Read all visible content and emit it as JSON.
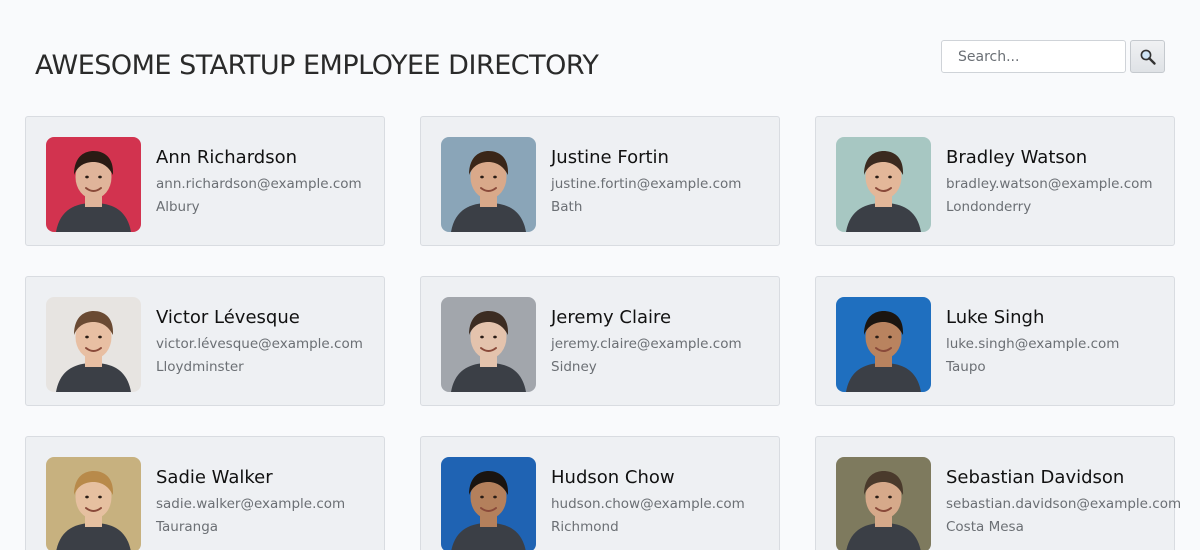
{
  "header": {
    "title": "AWESOME STARTUP EMPLOYEE DIRECTORY",
    "search_placeholder": "Search...",
    "search_icon": "magnifier-icon"
  },
  "employees": [
    {
      "name": "Ann Richardson",
      "email": "ann.richardson@example.com",
      "city": "Albury",
      "bg": "#d2334f",
      "skin": "#e0b49a",
      "hair": "#2a1b14"
    },
    {
      "name": "Justine Fortin",
      "email": "justine.fortin@example.com",
      "city": "Bath",
      "bg": "#8aa5b8",
      "skin": "#d9a98a",
      "hair": "#3a2618"
    },
    {
      "name": "Bradley Watson",
      "email": "bradley.watson@example.com",
      "city": "Londonderry",
      "bg": "#a7c7c2",
      "skin": "#e3b799",
      "hair": "#3b2a1f"
    },
    {
      "name": "Victor Lévesque",
      "email": "victor.lévesque@example.com",
      "city": "Lloydminster",
      "bg": "#e7e4e1",
      "skin": "#e8bfa3",
      "hair": "#6a4a33"
    },
    {
      "name": "Jeremy Claire",
      "email": "jeremy.claire@example.com",
      "city": "Sidney",
      "bg": "#a2a6ac",
      "skin": "#e4c3ad",
      "hair": "#3c2c22"
    },
    {
      "name": "Luke Singh",
      "email": "luke.singh@example.com",
      "city": "Taupo",
      "bg": "#1f6fbf",
      "skin": "#b9835f",
      "hair": "#1b1510"
    },
    {
      "name": "Sadie Walker",
      "email": "sadie.walker@example.com",
      "city": "Tauranga",
      "bg": "#c7b17f",
      "skin": "#e6c0a0",
      "hair": "#b88a4a"
    },
    {
      "name": "Hudson Chow",
      "email": "hudson.chow@example.com",
      "city": "Richmond",
      "bg": "#1f63b3",
      "skin": "#b4805c",
      "hair": "#1a1410"
    },
    {
      "name": "Sebastian Davidson",
      "email": "sebastian.davidson@example.com",
      "city": "Costa Mesa",
      "bg": "#7e7a5e",
      "skin": "#d6a98a",
      "hair": "#4a3a2c"
    }
  ]
}
